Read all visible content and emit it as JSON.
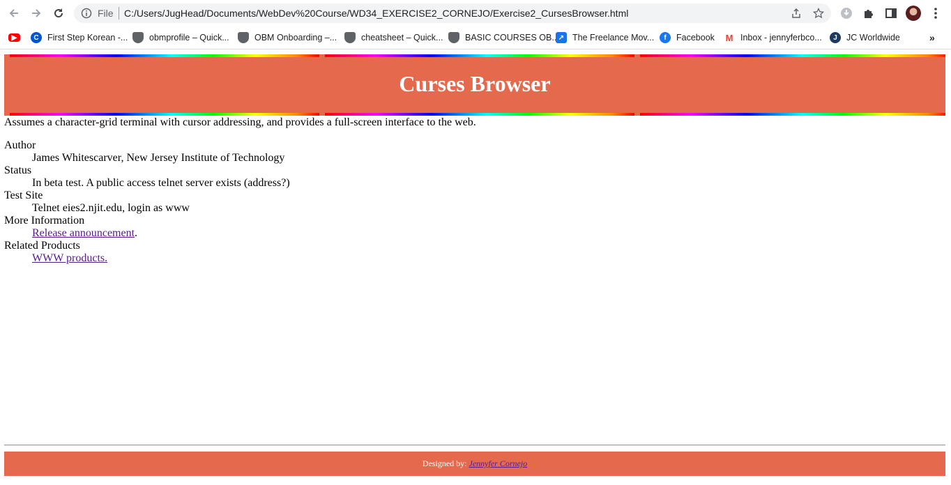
{
  "browser": {
    "address_file_label": "File",
    "url": "C:/Users/JugHead/Documents/WebDev%20Course/WD34_EXERCISE2_CORNEJO/Exercise2_CursesBrowser.html",
    "bookmarks": [
      {
        "label": "",
        "icon": "youtube-icon"
      },
      {
        "label": "First Step Korean -...",
        "icon": "coursera-icon"
      },
      {
        "label": "obmprofile – Quick...",
        "icon": "shield-icon"
      },
      {
        "label": "OBM Onboarding –...",
        "icon": "shield-icon"
      },
      {
        "label": "cheatsheet – Quick...",
        "icon": "shield-icon"
      },
      {
        "label": "BASIC COURSES OB...",
        "icon": "shield-icon"
      },
      {
        "label": "The Freelance Mov...",
        "icon": "freelance-icon"
      },
      {
        "label": "Facebook",
        "icon": "facebook-icon"
      },
      {
        "label": "Inbox - jennyferbco...",
        "icon": "gmail-icon"
      },
      {
        "label": "JC Worldwide",
        "icon": "jc-icon"
      }
    ],
    "more_bookmarks": "»"
  },
  "page": {
    "title": "Curses Browser",
    "description": "Assumes a character-grid terminal with cursor addressing, and provides a full-screen interface to the web.",
    "details": [
      {
        "term": "Author",
        "value": "James Whitescarver, New Jersey Institute of Technology"
      },
      {
        "term": "Status",
        "value": "In beta test. A public access telnet server exists (address?)"
      },
      {
        "term": "Test Site",
        "value": "Telnet eies2.njit.edu, login as www"
      }
    ],
    "more_info_term": "More Information",
    "more_info_link": "Release announcement",
    "more_info_suffix": ".",
    "related_term": "Related Products",
    "related_link": "WWW products.",
    "footer_prefix": "Designed by: ",
    "footer_link": "Jennyfer Cornejo"
  },
  "colors": {
    "header_bg": "#e5694d",
    "link": "#551a8b"
  }
}
